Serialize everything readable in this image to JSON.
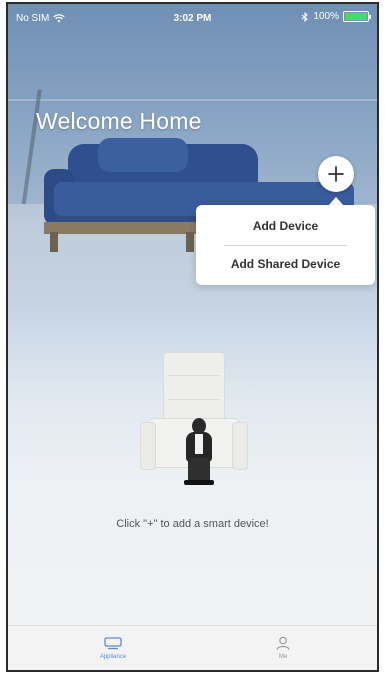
{
  "status_bar": {
    "carrier": "No SIM",
    "time": "3:02 PM",
    "battery": "100%",
    "battery_level": 1.0
  },
  "header": {
    "title": "Welcome Home"
  },
  "add_button": {
    "icon": "plus-icon"
  },
  "popup_menu": {
    "items": [
      {
        "label": "Add Device"
      },
      {
        "label": "Add Shared Device"
      }
    ]
  },
  "empty_state": {
    "hint": "Click \"+\" to add a smart device!"
  },
  "tab_bar": {
    "tabs": [
      {
        "label": "Appliance",
        "icon": "appliance-icon",
        "active": true
      },
      {
        "label": "Me",
        "icon": "person-icon",
        "active": false
      }
    ]
  },
  "colors": {
    "accent": "#5b8bd6",
    "battery": "#4cd964",
    "sofa": "#3a5c9c"
  }
}
